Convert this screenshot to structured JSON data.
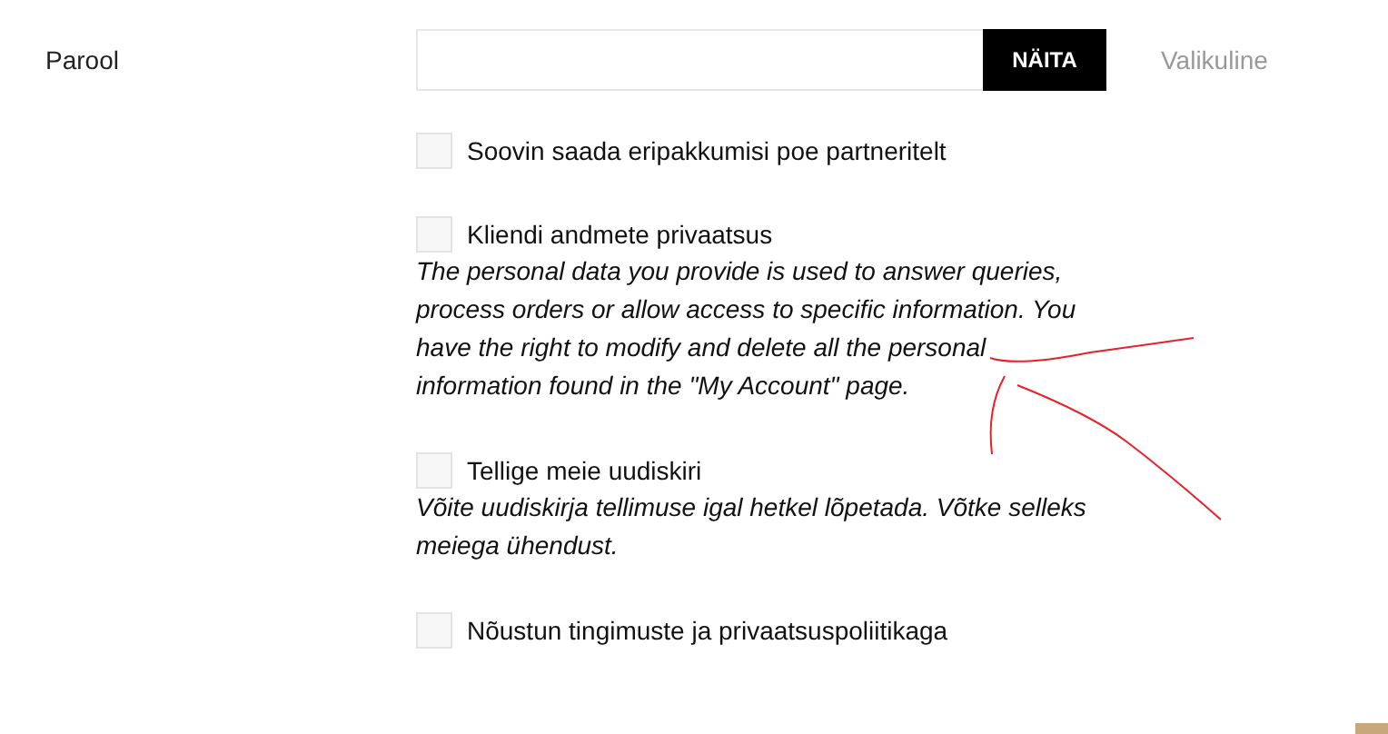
{
  "password": {
    "label": "Parool",
    "button": "NÄITA",
    "hint": "Valikuline"
  },
  "options": [
    {
      "label": "Soovin saada eripakkumisi poe partneritelt",
      "checked": false
    },
    {
      "label": "Kliendi andmete privaatsus",
      "checked": false,
      "description": "The personal data you provide is used to answer queries, process orders or allow access to specific information. You have the right to modify and delete all the personal information found in the \"My Account\" page."
    },
    {
      "label": "Tellige meie uudiskiri",
      "checked": false,
      "description": "Võite uudiskirja tellimuse igal hetkel lõpetada. Võtke selleks meiega ühendust."
    },
    {
      "label": "Nõustun tingimuste ja privaatsuspoliitikaga",
      "checked": false
    }
  ]
}
